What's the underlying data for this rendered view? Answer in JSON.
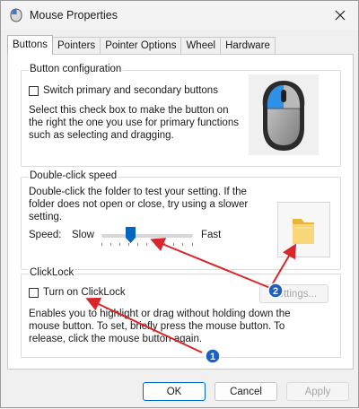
{
  "window": {
    "title": "Mouse Properties"
  },
  "tabs": [
    "Buttons",
    "Pointers",
    "Pointer Options",
    "Wheel",
    "Hardware"
  ],
  "button_configuration": {
    "legend": "Button configuration",
    "checkbox_label": "Switch primary and secondary buttons",
    "checked": false,
    "description": "Select this check box to make the button on the right the one you use for primary functions such as selecting and dragging."
  },
  "double_click": {
    "legend": "Double-click speed",
    "description": "Double-click the folder to test your setting. If the folder does not open or close, try using a slower setting.",
    "speed_label": "Speed:",
    "slow_label": "Slow",
    "fast_label": "Fast",
    "speed_value_fraction": 0.3
  },
  "clicklock": {
    "legend": "ClickLock",
    "checkbox_label": "Turn on ClickLock",
    "checked": false,
    "settings_button": "Settings...",
    "description": "Enables you to highlight or drag without holding down the mouse button. To set, briefly press the mouse button. To release, click the mouse button again."
  },
  "footer": {
    "ok": "OK",
    "cancel": "Cancel",
    "apply": "Apply"
  },
  "annotations": {
    "marker1": "1",
    "marker2": "2"
  },
  "colors": {
    "accent": "#0067c0",
    "annotation": "#d9262c",
    "marker_fill": "#1f5fbf"
  },
  "icons": {
    "app": "mouse-icon",
    "close": "close-icon",
    "folder": "folder-icon",
    "mouse_image": "mouse-illustration"
  }
}
